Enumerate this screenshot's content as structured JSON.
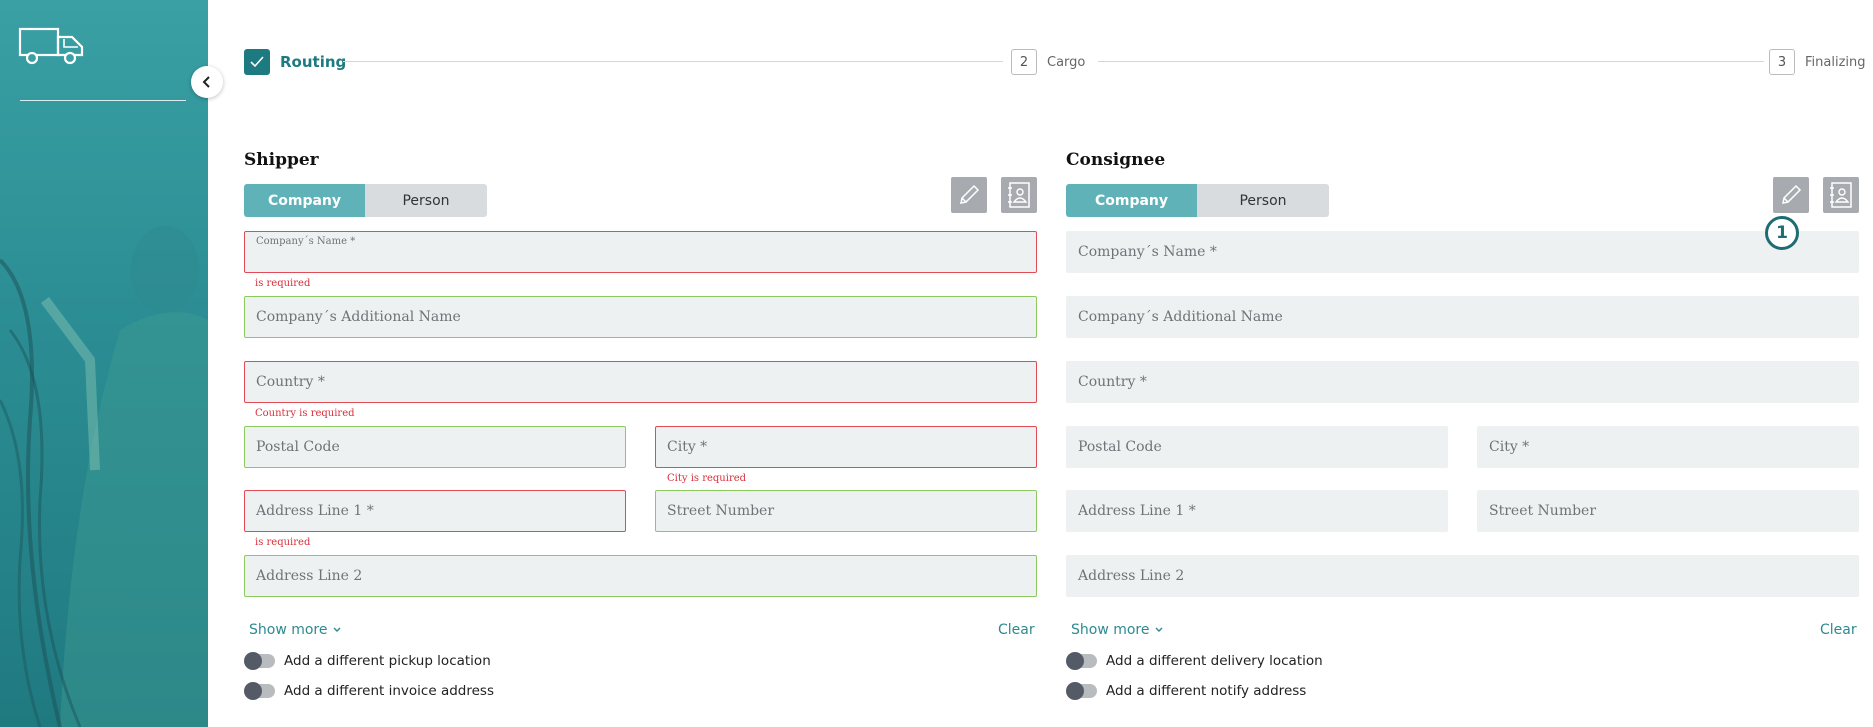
{
  "stepper": {
    "steps": [
      {
        "number": "",
        "label": "Routing",
        "state": "completed"
      },
      {
        "number": "2",
        "label": "Cargo",
        "state": "pending"
      },
      {
        "number": "3",
        "label": "Finalizing",
        "state": "pending"
      }
    ]
  },
  "shipper": {
    "title": "Shipper",
    "tabs": {
      "company": "Company",
      "person": "Person",
      "selected": "Company"
    },
    "fields": {
      "company_name": {
        "label": "Company´s Name *",
        "error": "is required"
      },
      "additional_name": {
        "label": "Company´s Additional Name"
      },
      "country": {
        "label": "Country *",
        "error": "Country is required"
      },
      "postal_code": {
        "label": "Postal Code"
      },
      "city": {
        "label": "City *",
        "error": "City is required"
      },
      "address1": {
        "label": "Address Line 1 *",
        "error": "is required"
      },
      "street_number": {
        "label": "Street Number"
      },
      "address2": {
        "label": "Address Line 2"
      }
    },
    "show_more": "Show more",
    "clear": "Clear",
    "toggles": [
      "Add a different pickup location",
      "Add a different invoice address"
    ]
  },
  "consignee": {
    "title": "Consignee",
    "tabs": {
      "company": "Company",
      "person": "Person",
      "selected": "Company"
    },
    "fields": {
      "company_name": {
        "label": "Company´s Name *"
      },
      "additional_name": {
        "label": "Company´s Additional Name"
      },
      "country": {
        "label": "Country *"
      },
      "postal_code": {
        "label": "Postal Code"
      },
      "city": {
        "label": "City *"
      },
      "address1": {
        "label": "Address Line 1 *"
      },
      "street_number": {
        "label": "Street Number"
      },
      "address2": {
        "label": "Address Line 2"
      }
    },
    "show_more": "Show more",
    "clear": "Clear",
    "toggles": [
      "Add a different delivery location",
      "Add a different notify address"
    ]
  },
  "annotation_badge": "1",
  "colors": {
    "primary": "#1d7a80",
    "tab_active": "#5fb3b8",
    "error": "#e04b56",
    "valid": "#8cc95e",
    "field_bg": "#eef1f2"
  },
  "icons": [
    "truck-icon",
    "chevron-left-icon",
    "check-icon",
    "pencil-icon",
    "contact-book-icon",
    "chevron-down-icon"
  ]
}
